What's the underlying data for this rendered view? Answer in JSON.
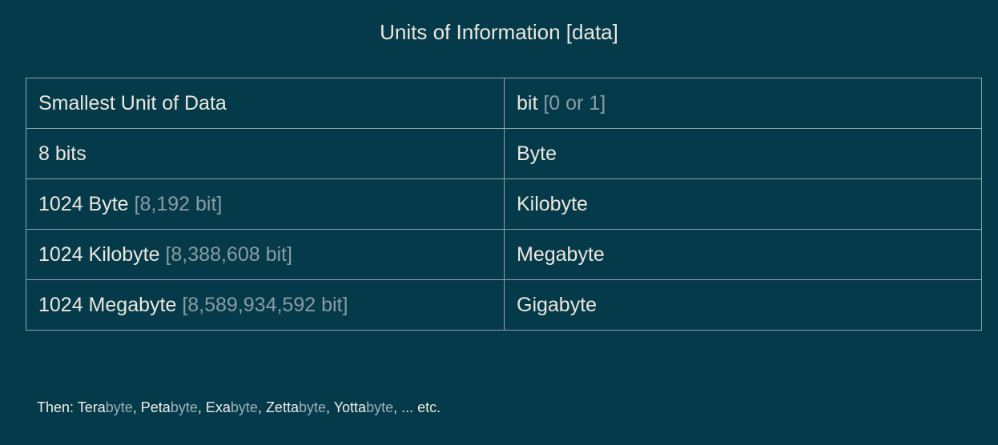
{
  "title": "Units of Information [data]",
  "rows": [
    {
      "left_main": "Smallest Unit of Data",
      "left_note": "",
      "right_main": "bit",
      "right_note": "[0 or 1]"
    },
    {
      "left_main": "8 bits",
      "left_note": "",
      "right_main": "Byte",
      "right_note": ""
    },
    {
      "left_main": "1024 Byte",
      "left_note": "[8,192 bit]",
      "right_main": "Kilobyte",
      "right_note": ""
    },
    {
      "left_main": "1024 Kilobyte",
      "left_note": "[8,388,608 bit]",
      "right_main": "Megabyte",
      "right_note": ""
    },
    {
      "left_main": "1024 Megabyte",
      "left_note": "[8,589,934,592 bit]",
      "right_main": "Gigabyte",
      "right_note": ""
    }
  ],
  "footer": {
    "label": "Then:",
    "items": [
      {
        "prefix": "Tera",
        "suffix": "byte"
      },
      {
        "prefix": "Peta",
        "suffix": "byte"
      },
      {
        "prefix": "Exa",
        "suffix": "byte"
      },
      {
        "prefix": "Zetta",
        "suffix": "byte"
      },
      {
        "prefix": "Yotta",
        "suffix": "byte"
      }
    ],
    "separator": ", ",
    "tail": ", ... etc."
  }
}
